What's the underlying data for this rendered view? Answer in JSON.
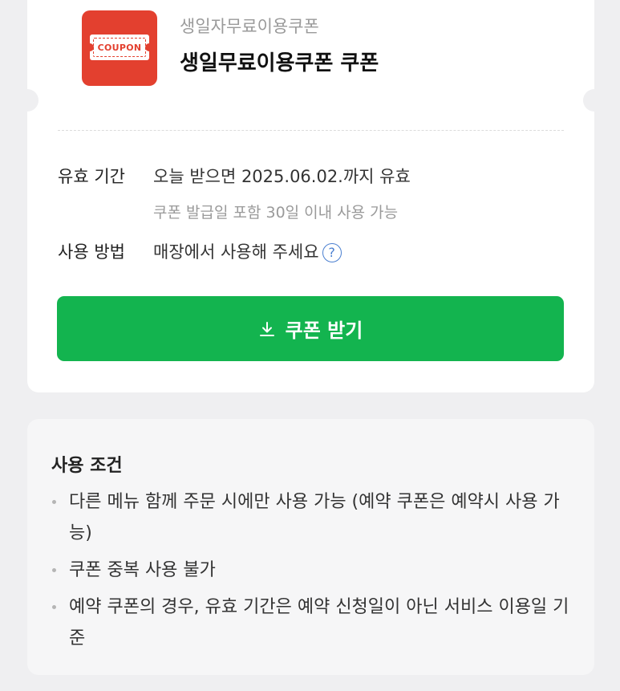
{
  "coupon": {
    "logo_text": "COUPON",
    "subtitle": "생일자무료이용쿠폰",
    "title": "생일무료이용쿠폰 쿠폰"
  },
  "validity": {
    "label": "유효 기간",
    "value": "오늘 받으면 2025.06.02.까지 유효",
    "note": "쿠폰 발급일 포함 30일 이내 사용 가능"
  },
  "usage": {
    "label": "사용 방법",
    "value": "매장에서 사용해 주세요",
    "help_icon": "question-circle-icon"
  },
  "download_button": {
    "label": "쿠폰 받기",
    "icon": "download-icon"
  },
  "conditions": {
    "title": "사용 조건",
    "items": [
      "다른 메뉴 함께 주문 시에만 사용 가능 (예약 쿠폰은 예약시 사용 가능)",
      "쿠폰 중복 사용 불가",
      "예약 쿠폰의 경우, 유효 기간은 예약 신청일이 아닌 서비스 이용일 기준"
    ]
  },
  "colors": {
    "brand_green": "#13b44f",
    "coupon_red": "#e3402f",
    "help_blue": "#4a7fd0"
  }
}
